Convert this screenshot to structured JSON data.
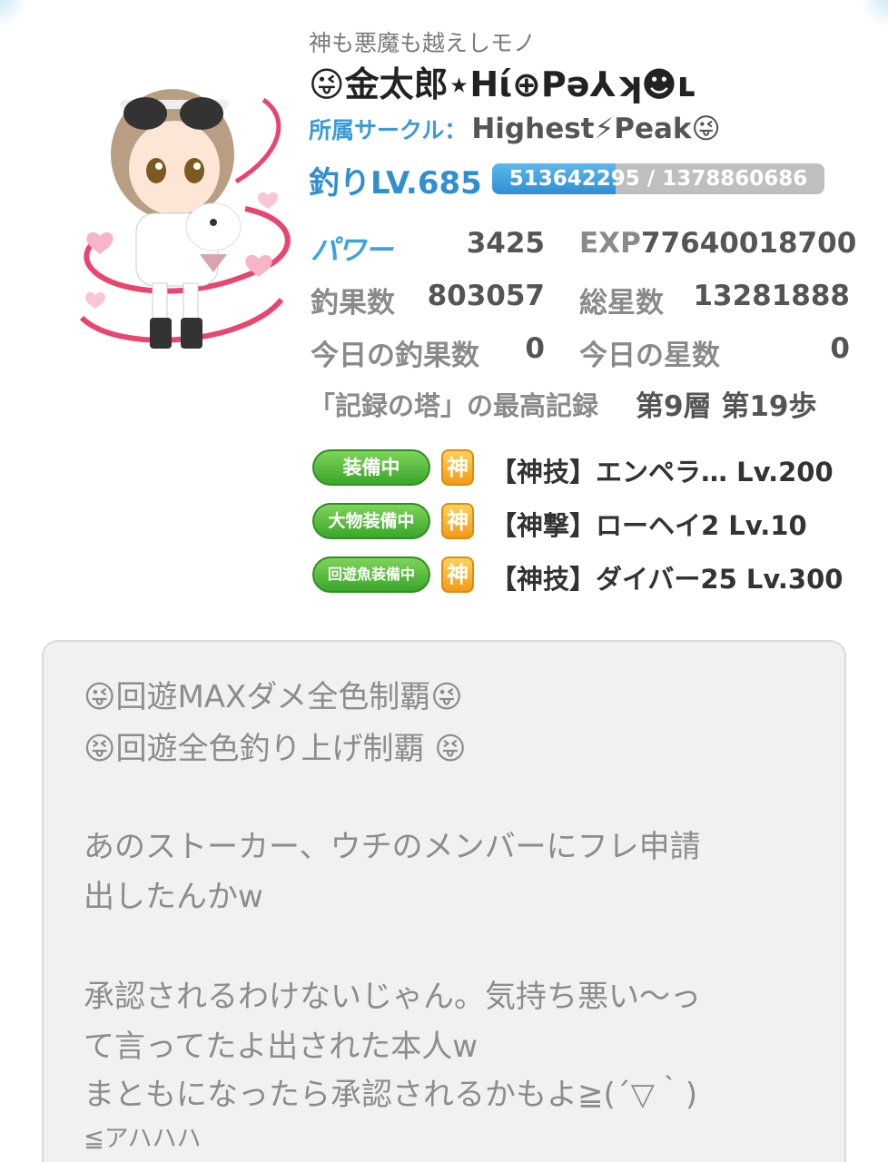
{
  "profile": {
    "title": "神も悪魔も越えしモノ",
    "name": "😜金太郎⋆Hί⊕Ρə⅄ʞ☻ʟ",
    "circle_label": "所属サークル：",
    "circle_name": "Highest⚡Peak😜",
    "level_label": "釣りLV.685",
    "exp_text": "513642295 / 1378860686",
    "exp_progress": 0.3725
  },
  "stats": {
    "power_label": "パワー",
    "power_value": "3425",
    "exp_label": "EXP",
    "exp_value": "77640018700",
    "catches_label": "釣果数",
    "catches_value": "803057",
    "total_stars_label": "総星数",
    "total_stars_value": "13281888",
    "today_catches_label": "今日の釣果数",
    "today_catches_value": "0",
    "today_stars_label": "今日の星数",
    "today_stars_value": "0",
    "record_label": "「記録の塔」の最高記録",
    "record_value": "第9層 第19歩"
  },
  "equipment": [
    {
      "badge": "装備中",
      "god": "神",
      "item": "【神技】エンペラ… Lv.200"
    },
    {
      "badge": "大物装備中",
      "god": "神",
      "item": "【神撃】ローヘイ2 Lv.10"
    },
    {
      "badge": "回遊魚装備中",
      "god": "神",
      "item": "【神技】ダイバー25 Lv.300"
    }
  ],
  "message": {
    "line1": "😜回遊MAXダメ全色制覇😜",
    "line2": "😝回遊全色釣り上げ制覇 😝",
    "line3": "あのストーカー、ウチのメンバーにフレ申請",
    "line4": "出したんかw",
    "line5": "承認されるわけないじゃん。気持ち悪い〜っ",
    "line6": "て言ってたよ出された本人w",
    "line7": "まともになったら承認されるかもよ≧(´▽｀)",
    "line8": "≦アハハハ"
  },
  "colors": {
    "accent": "#2f8fd0",
    "badge_green": "#3aa72b",
    "god_orange": "#f29b18"
  }
}
